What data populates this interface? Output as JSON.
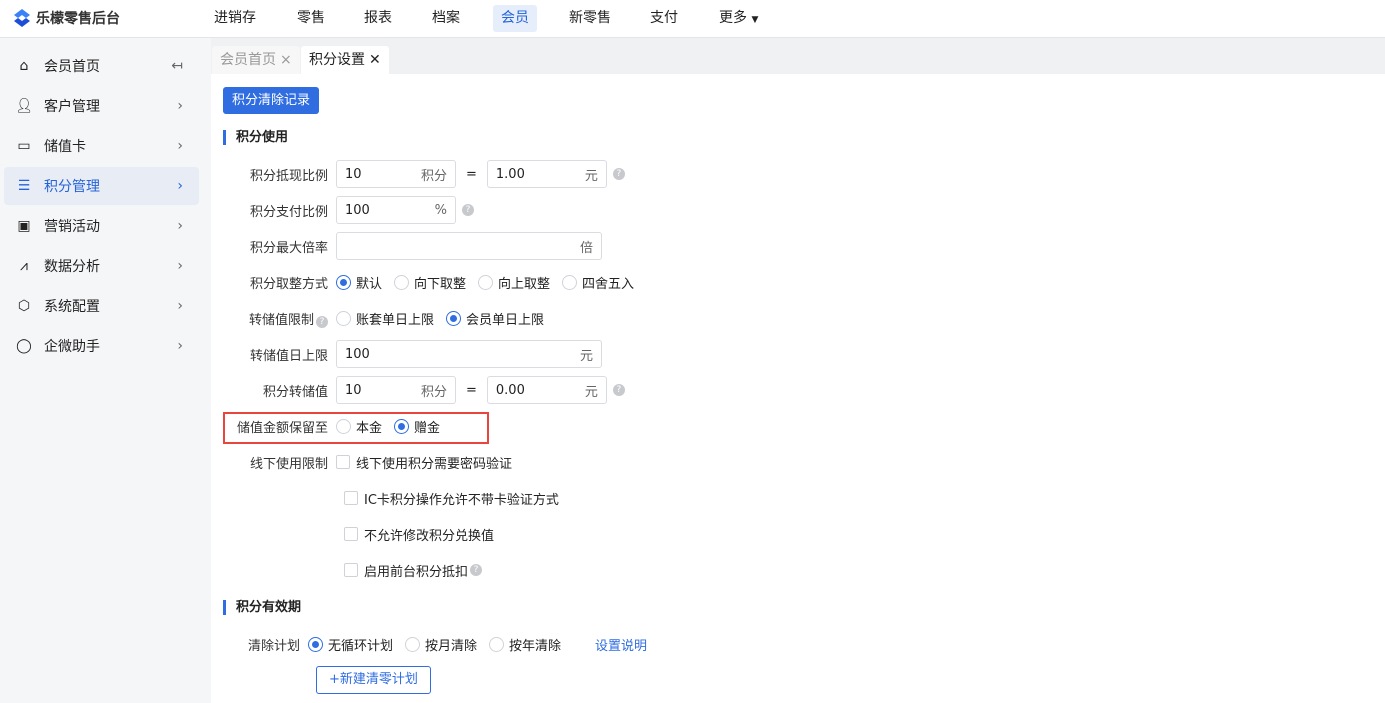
{
  "app": {
    "title": "乐檬零售后台"
  },
  "nav": [
    "进销存",
    "零售",
    "报表",
    "档案",
    "会员",
    "新零售",
    "支付",
    "更多"
  ],
  "sidebar": [
    "会员首页",
    "客户管理",
    "储值卡",
    "积分管理",
    "营销活动",
    "数据分析",
    "系统配置",
    "企微助手"
  ],
  "tabs": [
    {
      "label": "会员首页",
      "close": "×"
    },
    {
      "label": "积分设置",
      "close": "✕"
    }
  ],
  "main": {
    "clear_records_button": "积分清除记录",
    "section_usage": "积分使用",
    "ratio": {
      "label": "积分抵现比例",
      "points": "10",
      "points_unit": "积分",
      "eq": "=",
      "yuan": "1.00",
      "yuan_unit": "元"
    },
    "pay_ratio": {
      "label": "积分支付比例",
      "value": "100",
      "unit": "%"
    },
    "max_rate": {
      "label": "积分最大倍率",
      "value": "",
      "unit": "倍"
    },
    "rounding": {
      "label": "积分取整方式",
      "options": [
        "默认",
        "向下取整",
        "向上取整",
        "四舍五入"
      ]
    },
    "transfer_limit": {
      "label": "转储值限制",
      "options": [
        "账套单日上限",
        "会员单日上限"
      ]
    },
    "daily_limit": {
      "label": "转储值日上限",
      "value": "100",
      "unit": "元"
    },
    "transfer": {
      "label": "积分转储值",
      "points": "10",
      "points_unit": "积分",
      "eq": "=",
      "yuan": "0.00",
      "yuan_unit": "元"
    },
    "retain": {
      "label": "储值金额保留至",
      "options": [
        "本金",
        "赠金"
      ]
    },
    "offline": {
      "label": "线下使用限制",
      "options": [
        "线下使用积分需要密码验证",
        "IC卡积分操作允许不带卡验证方式",
        "不允许修改积分兑换值",
        "启用前台积分抵扣"
      ]
    },
    "section_validity": "积分有效期",
    "plan": {
      "label": "清除计划",
      "options": [
        "无循环计划",
        "按月清除",
        "按年清除"
      ],
      "link": "设置说明"
    },
    "new_plan_button": "+新建清零计划",
    "help": "?"
  },
  "colors": {
    "accent": "#2f6de1",
    "highlight": "#e8453c"
  }
}
